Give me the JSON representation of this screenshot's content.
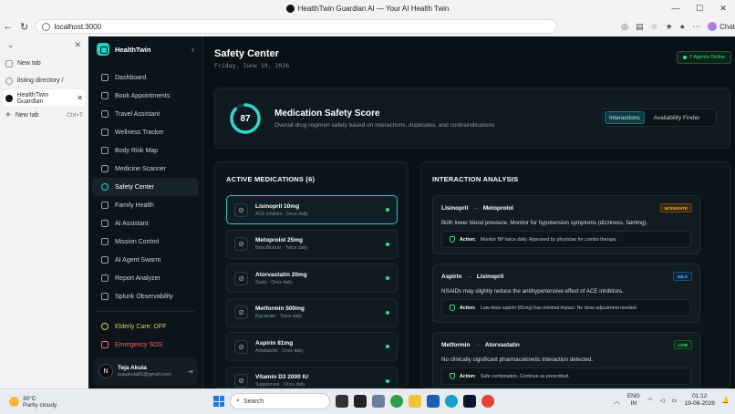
{
  "browser": {
    "window_title": "HealthTwin Guardian AI — Your AI Health Twin",
    "url": "localhost:3000",
    "chat_label": "Chat",
    "tabs": [
      {
        "label": "New tab"
      },
      {
        "label": "listing directory /"
      },
      {
        "label": "HealthTwin Guardian"
      },
      {
        "label": "New tab",
        "shortcut": "Ctrl+T"
      }
    ]
  },
  "app": {
    "brand": "HealthTwin",
    "nav": [
      {
        "label": "Dashboard",
        "icon": "dashboard-icon"
      },
      {
        "label": "Book Appointments",
        "icon": "calendar-icon"
      },
      {
        "label": "Travel Assistant",
        "icon": "plane-icon"
      },
      {
        "label": "Wellness Tracker",
        "icon": "heart-icon"
      },
      {
        "label": "Body Risk Map",
        "icon": "map-icon"
      },
      {
        "label": "Medicine Scanner",
        "icon": "scan-icon"
      },
      {
        "label": "Safety Center",
        "icon": "shield-icon"
      },
      {
        "label": "Family Health",
        "icon": "family-icon"
      },
      {
        "label": "AI Assistant",
        "icon": "bot-icon"
      },
      {
        "label": "Mission Control",
        "icon": "globe-icon"
      },
      {
        "label": "AI Agent Swarm",
        "icon": "swarm-icon"
      },
      {
        "label": "Report Analyzer",
        "icon": "report-icon"
      },
      {
        "label": "Splunk Observability",
        "icon": "database-icon"
      }
    ],
    "elderly_care": "Elderly Care: OFF",
    "emergency": "Emergency SOS",
    "user": {
      "initial": "N",
      "name": "Teja Akula",
      "email": "tejaakula81@gmail.com"
    }
  },
  "page": {
    "title": "Safety Center",
    "date": "Friday, June 19, 2026",
    "agents_badge": "7 Agents Online",
    "score": {
      "value": "87",
      "fraction": 0.87,
      "title": "Medication Safety Score",
      "subtitle": "Overall drug regimen safety based on interactions, duplicates, and contraindications"
    },
    "toggle": {
      "interactions": "Interactions",
      "availability": "Availability Finder"
    },
    "medications_title": "ACTIVE MEDICATIONS (6)",
    "medications": [
      {
        "name": "Lisinopril 10mg",
        "desc": "ACE Inhibitor · Once daily"
      },
      {
        "name": "Metoprolol 25mg",
        "desc": "Beta Blocker · Twice daily"
      },
      {
        "name": "Atorvastatin 20mg",
        "desc": "Statin · Once daily"
      },
      {
        "name": "Metformin 500mg",
        "desc": "Biguanide · Twice daily"
      },
      {
        "name": "Aspirin 81mg",
        "desc": "Antiplatelet · Once daily"
      },
      {
        "name": "Vitamin D3 2000 IU",
        "desc": "Supplement · Once daily"
      }
    ],
    "interaction_title": "INTERACTION ANALYSIS",
    "interactions": [
      {
        "drug_a": "Lisinopril",
        "drug_b": "Metoprolol",
        "severity": "MODERATE",
        "desc": "Both lower blood pressure. Monitor for hypotension symptoms (dizziness, fainting).",
        "action_label": "Action:",
        "action": "Monitor BP twice daily. Approved by physician for combo therapy."
      },
      {
        "drug_a": "Aspirin",
        "drug_b": "Lisinopril",
        "severity": "MILD",
        "desc": "NSAIDs may slightly reduce the antihypertensive effect of ACE inhibitors.",
        "action_label": "Action:",
        "action": "Low-dose aspirin (81mg) has minimal impact. No dose adjustment needed."
      },
      {
        "drug_a": "Metformin",
        "drug_b": "Atorvastatin",
        "severity": "LOW",
        "desc": "No clinically significant pharmacokinetic interaction detected.",
        "action_label": "Action:",
        "action": "Safe combination. Continue as prescribed."
      }
    ]
  },
  "taskbar": {
    "temp": "30°C",
    "condition": "Partly cloudy",
    "search": "Search",
    "lang": "ENG",
    "region": "IN",
    "time": "01:12",
    "date": "19-06-2026"
  },
  "colors": {
    "accent": "#2fd7c8",
    "moderate": "#f2b136",
    "mild": "#5ab0ff",
    "low": "#3ddc84",
    "sos": "#ff5b5b"
  }
}
